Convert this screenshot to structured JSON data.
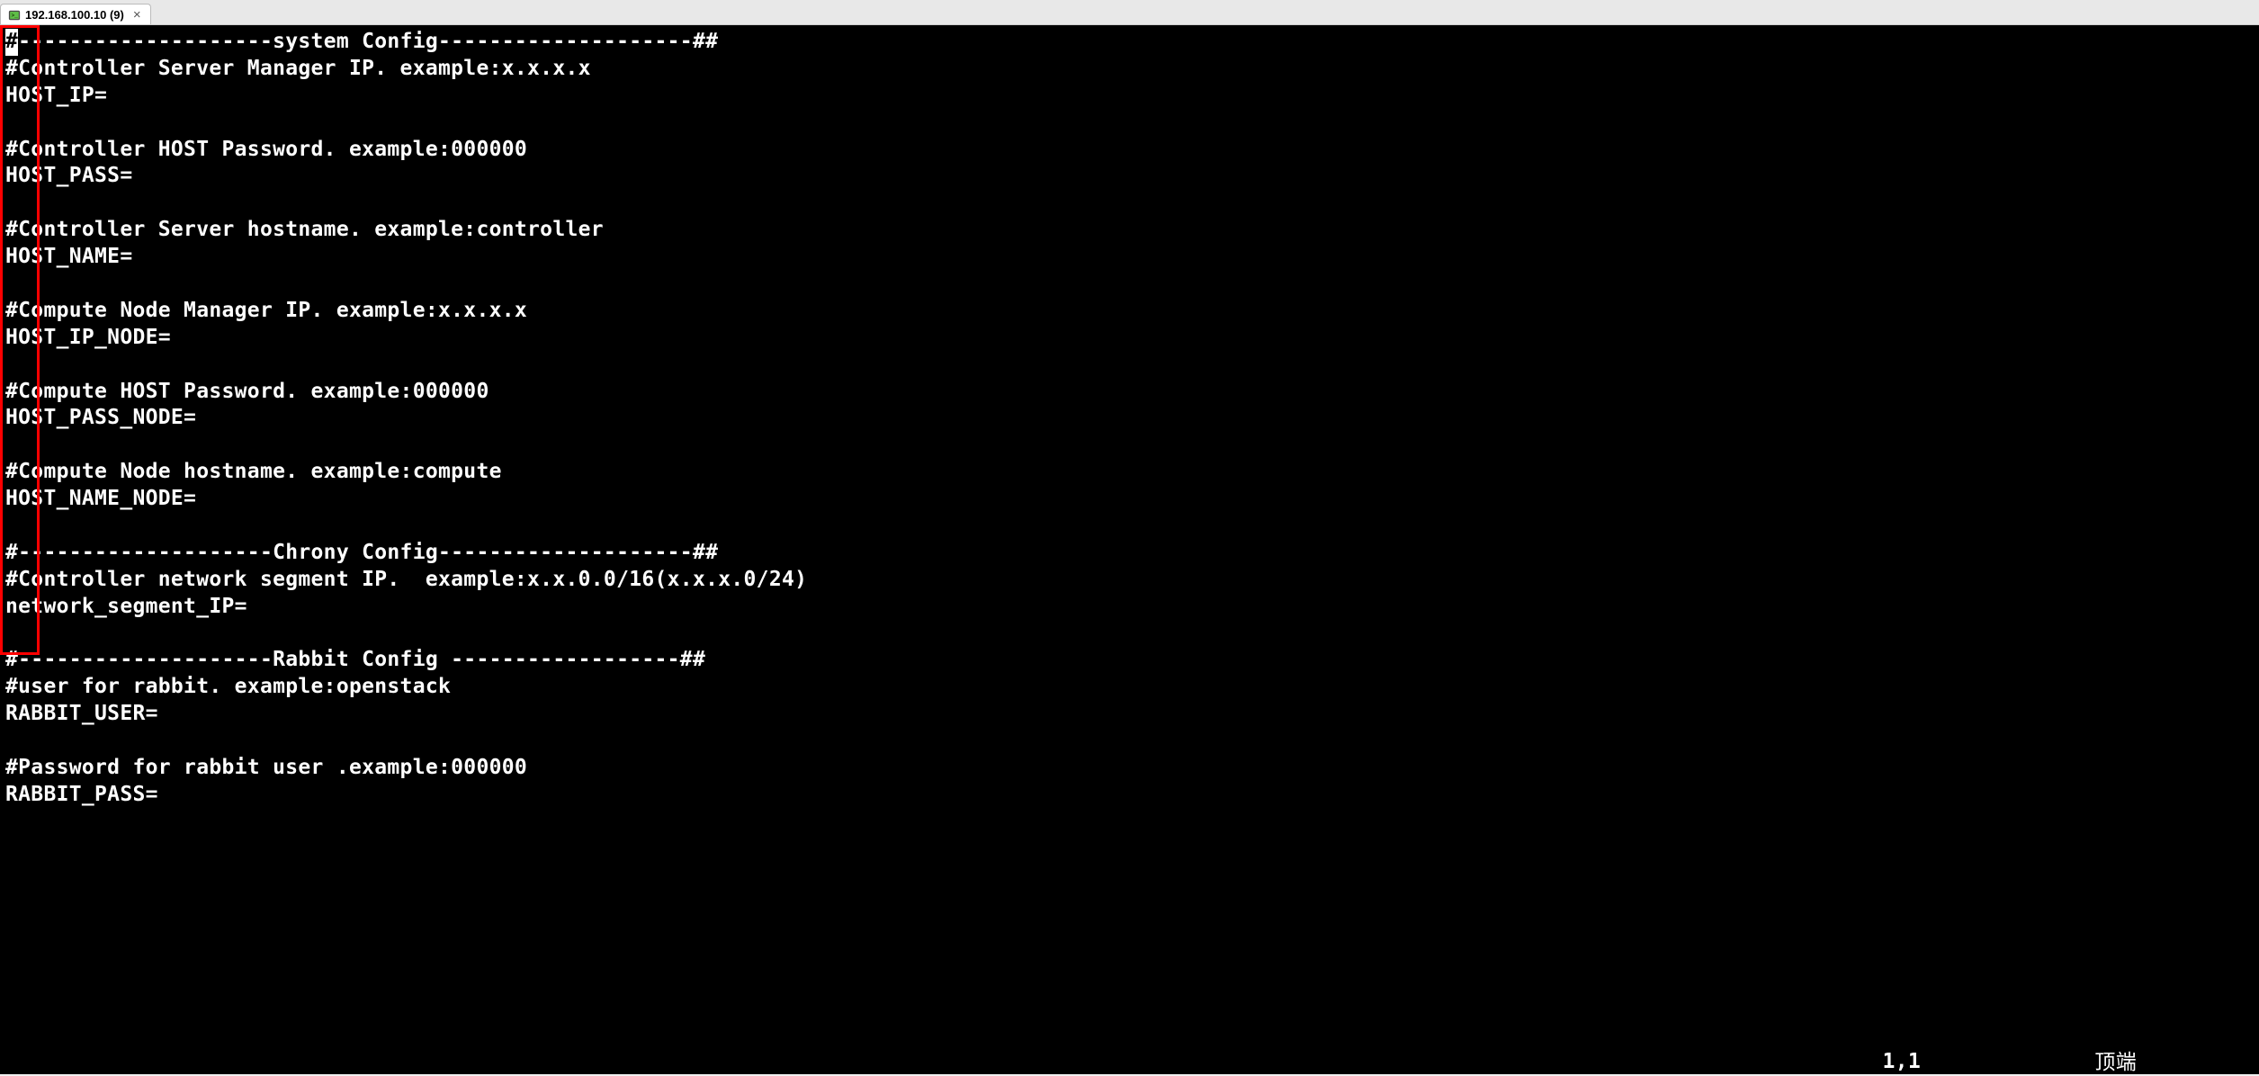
{
  "tab": {
    "label": "192.168.100.10 (9)",
    "close_glyph": "×"
  },
  "terminal": {
    "lines": [
      "#--------------------system Config--------------------##",
      "#Controller Server Manager IP. example:x.x.x.x",
      "HOST_IP=",
      "",
      "#Controller HOST Password. example:000000",
      "HOST_PASS=",
      "",
      "#Controller Server hostname. example:controller",
      "HOST_NAME=",
      "",
      "#Compute Node Manager IP. example:x.x.x.x",
      "HOST_IP_NODE=",
      "",
      "#Compute HOST Password. example:000000",
      "HOST_PASS_NODE=",
      "",
      "#Compute Node hostname. example:compute",
      "HOST_NAME_NODE=",
      "",
      "#--------------------Chrony Config--------------------##",
      "#Controller network segment IP.  example:x.x.0.0/16(x.x.x.0/24)",
      "network_segment_IP=",
      "",
      "#--------------------Rabbit Config ------------------##",
      "#user for rabbit. example:openstack",
      "RABBIT_USER=",
      "",
      "#Password for rabbit user .example:000000",
      "RABBIT_PASS="
    ]
  },
  "status": {
    "position": "1,1",
    "right": "顶端"
  }
}
